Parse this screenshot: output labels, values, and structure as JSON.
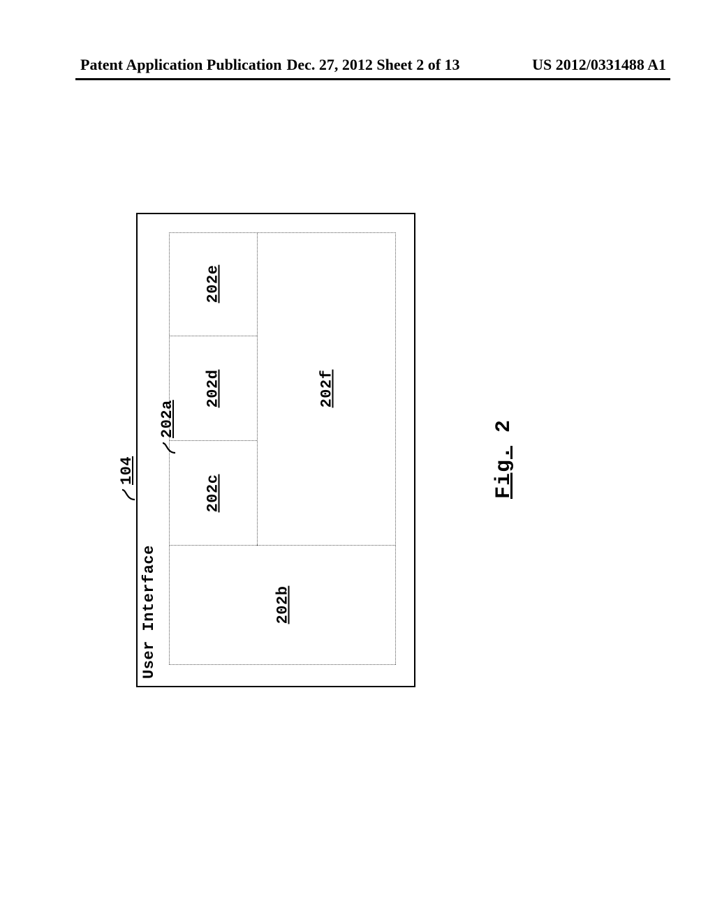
{
  "header": {
    "left": "Patent Application Publication",
    "center": "Dec. 27, 2012  Sheet 2 of 13",
    "right": "US 2012/0331488 A1"
  },
  "figure": {
    "outer_label": "User Interface",
    "callouts": {
      "outer": "104",
      "inner": "202a"
    },
    "cells": {
      "b": "202b",
      "c": "202c",
      "d": "202d",
      "e": "202e",
      "f": "202f"
    },
    "caption_word": "Fig.",
    "caption_num": "2"
  }
}
